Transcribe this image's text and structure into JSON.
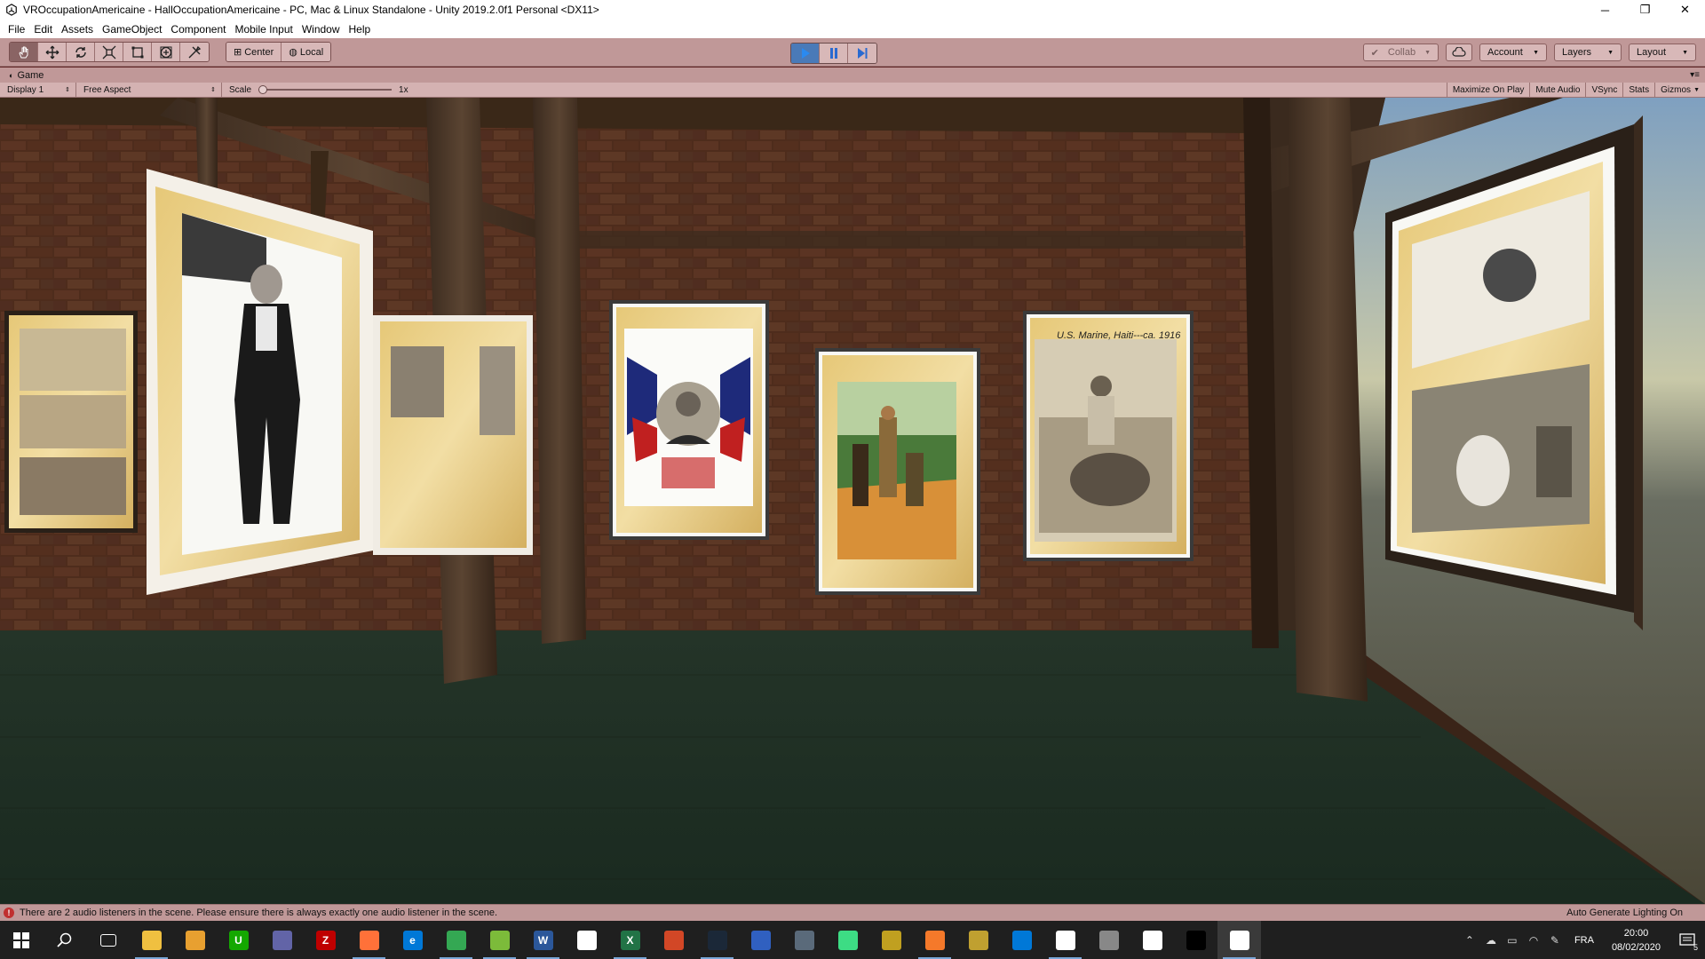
{
  "window": {
    "title": "VROccupationAmericaine - HallOccupationAmericaine - PC, Mac & Linux Standalone - Unity 2019.2.0f1 Personal <DX11>",
    "minimize": "─",
    "restore": "❐",
    "close": "✕"
  },
  "menu": [
    "File",
    "Edit",
    "Assets",
    "GameObject",
    "Component",
    "Mobile Input",
    "Window",
    "Help"
  ],
  "toolbar": {
    "tools": [
      "hand-tool",
      "move-tool",
      "rotate-tool",
      "scale-tool",
      "rect-tool",
      "transform-tool",
      "custom-tool"
    ],
    "pivot": "Center",
    "space": "Local",
    "collab": "Collab",
    "account": "Account",
    "layers": "Layers",
    "layout": "Layout"
  },
  "game_tab": {
    "label": "Game",
    "display": "Display 1",
    "aspect": "Free Aspect",
    "scale_label": "Scale",
    "scale_value": "1x",
    "maximize": "Maximize On Play",
    "mute": "Mute Audio",
    "vsync": "VSync",
    "stats": "Stats",
    "gizmos": "Gizmos"
  },
  "scene": {
    "poster_caption_marine": "U.S. Marine, Haiti---ca. 1916"
  },
  "status": {
    "message": "There are 2 audio listeners in the scene. Please ensure there is always exactly one audio listener in the scene.",
    "lighting": "Auto Generate Lighting On"
  },
  "taskbar": {
    "apps": [
      {
        "name": "task-view",
        "label": "",
        "color": "#1f1f1f"
      },
      {
        "name": "file-explorer",
        "label": "",
        "color": "#f0c040"
      },
      {
        "name": "app-orange",
        "label": "",
        "color": "#e8a030"
      },
      {
        "name": "upwork",
        "label": "U",
        "color": "#14a800"
      },
      {
        "name": "teams",
        "label": "",
        "color": "#6264a7"
      },
      {
        "name": "filezilla",
        "label": "Z",
        "color": "#bf0000"
      },
      {
        "name": "firefox",
        "label": "",
        "color": "#ff7139"
      },
      {
        "name": "edge",
        "label": "e",
        "color": "#0078d7"
      },
      {
        "name": "chrome",
        "label": "",
        "color": "#34a853"
      },
      {
        "name": "notepad-plus",
        "label": "",
        "color": "#7cbb3a"
      },
      {
        "name": "word",
        "label": "W",
        "color": "#2b579a"
      },
      {
        "name": "blank-doc",
        "label": "",
        "color": "#ffffff"
      },
      {
        "name": "excel",
        "label": "X",
        "color": "#217346"
      },
      {
        "name": "powerpoint",
        "label": "",
        "color": "#d24726"
      },
      {
        "name": "steam",
        "label": "",
        "color": "#1b2838"
      },
      {
        "name": "app-blue",
        "label": "",
        "color": "#3060c0"
      },
      {
        "name": "app-window",
        "label": "",
        "color": "#5a6a7a"
      },
      {
        "name": "android-studio",
        "label": "",
        "color": "#3ddc84"
      },
      {
        "name": "app-clapper",
        "label": "",
        "color": "#c0a020"
      },
      {
        "name": "blender",
        "label": "",
        "color": "#f5792a"
      },
      {
        "name": "git-kraken",
        "label": "",
        "color": "#c0a030"
      },
      {
        "name": "maps",
        "label": "",
        "color": "#0078d7"
      },
      {
        "name": "unity-hub",
        "label": "",
        "color": "#ffffff"
      },
      {
        "name": "database",
        "label": "",
        "color": "#888888"
      },
      {
        "name": "app-bars",
        "label": "",
        "color": "#ffffff"
      },
      {
        "name": "terminal",
        "label": "",
        "color": "#000000"
      },
      {
        "name": "unity",
        "label": "",
        "color": "#ffffff"
      }
    ],
    "language": "FRA",
    "time": "20:00",
    "date": "08/02/2020",
    "notifications": "5"
  }
}
